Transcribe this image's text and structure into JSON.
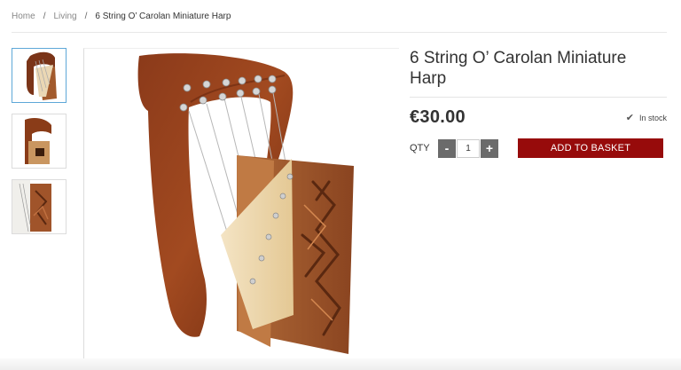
{
  "breadcrumb": {
    "items": [
      "Home",
      "Living"
    ],
    "separator": "/",
    "current": "6 String O’ Carolan Miniature Harp"
  },
  "product": {
    "title": "6 String O’ Carolan Miniature Harp",
    "price": "€30.00",
    "stock": "In stock",
    "qty_label": "QTY",
    "qty_value": "1",
    "minus": "-",
    "plus": "+",
    "add_to_basket": "ADD TO BASKET"
  },
  "gallery": {
    "thumbnails": [
      "harp-front-thumbnail",
      "harp-side-thumbnail",
      "harp-carving-thumbnail"
    ],
    "active_thumbnail": 1
  },
  "colors": {
    "accent_button": "#970b0b",
    "qty_button": "#6b6b6b",
    "active_thumb_border": "#5ea8d8"
  },
  "icons": {
    "stock": "check-icon"
  }
}
